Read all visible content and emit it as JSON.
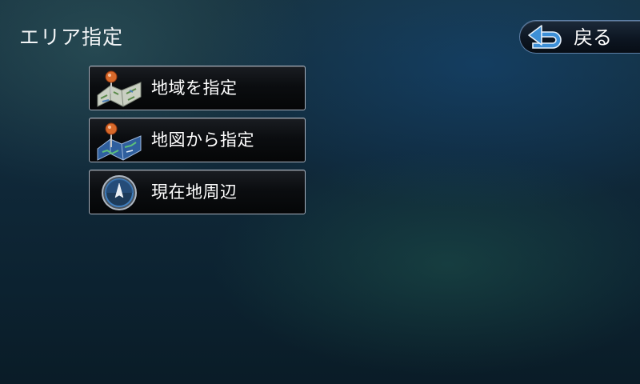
{
  "header": {
    "title": "エリア指定",
    "back_label": "戻る",
    "back_icon": "return-arrow-icon"
  },
  "menu": {
    "items": [
      {
        "label": "地域を指定",
        "icon": "map-pin-icon"
      },
      {
        "label": "地図から指定",
        "icon": "map-pin-icon"
      },
      {
        "label": "現在地周辺",
        "icon": "compass-icon"
      }
    ]
  },
  "colors": {
    "accent": "#5e7fa6",
    "text": "#ffffff",
    "pin": "#d8692a"
  }
}
